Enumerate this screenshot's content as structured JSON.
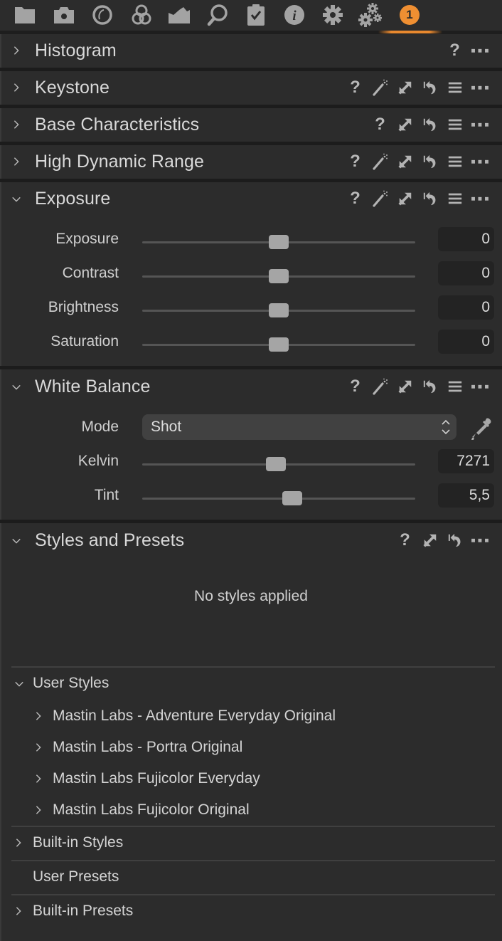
{
  "tabbar": {
    "tabs": [
      {
        "name": "library-tab",
        "icon": "folder-icon"
      },
      {
        "name": "capture-tab",
        "icon": "camera-icon"
      },
      {
        "name": "lens-tab",
        "icon": "lens-icon"
      },
      {
        "name": "color-tab",
        "icon": "color-circles-icon"
      },
      {
        "name": "exposure-tab",
        "icon": "histogram-icon"
      },
      {
        "name": "details-tab",
        "icon": "magnifier-icon"
      },
      {
        "name": "adjustments-tab",
        "icon": "clipboard-check-icon"
      },
      {
        "name": "metadata-tab",
        "icon": "info-icon"
      },
      {
        "name": "output-tab",
        "icon": "gear-icon"
      },
      {
        "name": "batch-tab",
        "icon": "gears-icon"
      },
      {
        "name": "custom-tab",
        "icon": "badge-icon",
        "badge": "1",
        "active": true
      }
    ],
    "accent_color": "#ef8f32"
  },
  "tools": {
    "histogram": {
      "title": "Histogram",
      "expanded": false
    },
    "keystone": {
      "title": "Keystone",
      "expanded": false
    },
    "base": {
      "title": "Base Characteristics",
      "expanded": false
    },
    "hdr": {
      "title": "High Dynamic Range",
      "expanded": false
    },
    "exposure": {
      "title": "Exposure",
      "expanded": true,
      "sliders": [
        {
          "label": "Exposure",
          "value": "0",
          "position": 0.5
        },
        {
          "label": "Contrast",
          "value": "0",
          "position": 0.5
        },
        {
          "label": "Brightness",
          "value": "0",
          "position": 0.5
        },
        {
          "label": "Saturation",
          "value": "0",
          "position": 0.5
        }
      ]
    },
    "white_balance": {
      "title": "White Balance",
      "expanded": true,
      "mode_label": "Mode",
      "mode_value": "Shot",
      "sliders": [
        {
          "label": "Kelvin",
          "value": "7271",
          "position": 0.49
        },
        {
          "label": "Tint",
          "value": "5,5",
          "position": 0.55
        }
      ]
    },
    "styles": {
      "title": "Styles and Presets",
      "expanded": true,
      "empty_message": "No styles applied",
      "user_styles": {
        "label": "User Styles",
        "expanded": true,
        "items": [
          "Mastin Labs - Adventure Everyday Original",
          "Mastin Labs - Portra Original",
          "Mastin Labs Fujicolor Everyday",
          "Mastin Labs Fujicolor Original"
        ]
      },
      "builtin_styles": "Built-in Styles",
      "user_presets": "User Presets",
      "builtin_presets": "Built-in Presets"
    }
  },
  "header_icons": {
    "help": "?",
    "names": [
      "help-icon",
      "auto-adjust-wand-icon",
      "copy-apply-icon",
      "reset-icon",
      "presets-menu-icon",
      "more-icon"
    ]
  }
}
